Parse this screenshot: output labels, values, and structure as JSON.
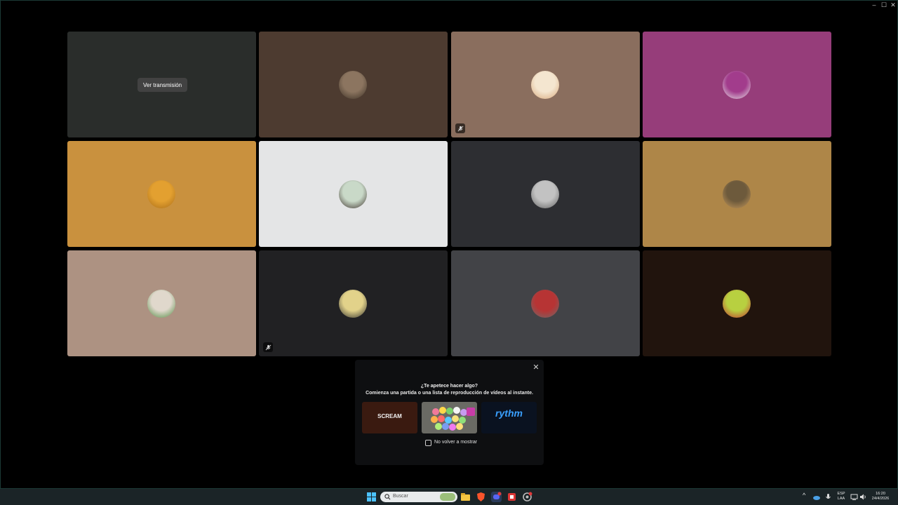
{
  "window": {
    "controls": {
      "minimize": "–",
      "maximize": "☐",
      "close": "✕"
    }
  },
  "tiles": [
    {
      "id": "stream",
      "bg": "#2a2d2b",
      "button": "Ver transmisión"
    },
    {
      "bg": "#4d3b30",
      "avatar": "cat-avatar",
      "avatarColors": [
        "#8c7560",
        "#3a2f24"
      ]
    },
    {
      "bg": "#8a6e5e",
      "avatar": "cartoon-avatar",
      "avatarColors": [
        "#f4e6d0",
        "#d7a77a"
      ],
      "muted": true
    },
    {
      "bg": "#963d7a",
      "avatar": "anime-avatar",
      "avatarColors": [
        "#a23c8c",
        "#e8e8e8"
      ]
    },
    {
      "bg": "#c9913e",
      "avatar": "fruit-avatar",
      "avatarColors": [
        "#e3a030",
        "#a86c18"
      ]
    },
    {
      "bg": "#e4e5e6",
      "avatar": "girl-avatar",
      "avatarColors": [
        "#c9d9c8",
        "#3b2f2a"
      ]
    },
    {
      "bg": "#2d2e32",
      "avatar": "gray-avatar",
      "avatarColors": [
        "#c2c2c2",
        "#5e5e5e"
      ]
    },
    {
      "bg": "#ae8648",
      "avatar": "group-avatar",
      "avatarColors": [
        "#6d5a3c",
        "#c99b5c"
      ]
    },
    {
      "bg": "#ad9282",
      "avatar": "photo-avatar",
      "avatarColors": [
        "#e0d8cc",
        "#4d8a3f"
      ]
    },
    {
      "bg": "#212123",
      "avatar": "frog-avatar",
      "avatarColors": [
        "#e2d28a",
        "#2b2b2b"
      ],
      "muted": true
    },
    {
      "bg": "#424347",
      "avatar": "robot-avatar",
      "avatarColors": [
        "#b73434",
        "#6b6b6b"
      ]
    },
    {
      "bg": "#21140d",
      "avatar": "avocado-avatar",
      "avatarColors": [
        "#b8d040",
        "#c23030"
      ]
    }
  ],
  "popup": {
    "title": "¿Te apetece hacer algo?",
    "subtitle": "Comienza una partida o una lista de reproducción de vídeos al instante.",
    "activities": [
      {
        "label": "SCREAM",
        "bg": "#3a1a10",
        "color": "#f2f2f2"
      },
      {
        "label": "",
        "bg": "#6a6a64",
        "color": "#ffffff"
      },
      {
        "label": "rythm",
        "bg": "#0a1220",
        "color": "#3aa0ff"
      }
    ],
    "checkbox_label": "No volver a mostrar",
    "close": "✕"
  },
  "taskbar": {
    "search_placeholder": "Buscar",
    "lang_top": "ESP",
    "lang_bottom": "LAA",
    "time": "16:20",
    "date": "24/4/2026",
    "tray_chevron": "^"
  }
}
